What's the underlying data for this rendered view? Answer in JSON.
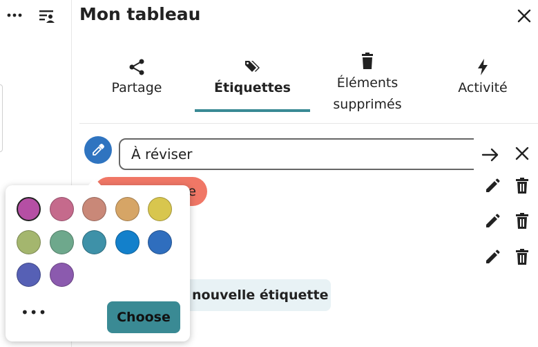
{
  "header": {
    "title": "Mon tableau"
  },
  "tabs": [
    {
      "label": "Partage",
      "icon": "share-icon"
    },
    {
      "label": "Étiquettes",
      "icon": "tags-icon",
      "active": true
    },
    {
      "label_line1": "Éléments",
      "label_line2": "supprimés",
      "icon": "trash-icon"
    },
    {
      "label": "Activité",
      "icon": "bolt-icon"
    }
  ],
  "edit_form": {
    "value": "À réviser"
  },
  "tag_partial": {
    "text": "e"
  },
  "new_tag_button": {
    "label": "nouvelle étiquette"
  },
  "color_picker": {
    "swatches": [
      "#b54fa4",
      "#c56a8c",
      "#c98878",
      "#d6a566",
      "#d8c64e",
      "#a4b66e",
      "#6ea88c",
      "#3e91a8",
      "#1380cb",
      "#2f6ebe",
      "#5660b5",
      "#8b5aae"
    ],
    "selected_index": 0,
    "more_label": "•••",
    "choose_label": "Choose"
  },
  "colors": {
    "accent": "#3a8a94",
    "picker_button": "#2f74c0",
    "tag_bg": "#f07766",
    "new_tag_bg": "#e8f2f5"
  }
}
